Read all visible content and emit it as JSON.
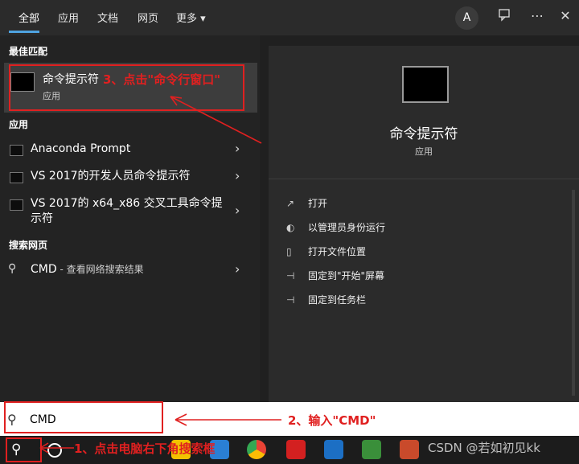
{
  "tabs": [
    "全部",
    "应用",
    "文档",
    "网页",
    "更多 ▾"
  ],
  "header": {
    "avatar": "A"
  },
  "best_match": {
    "heading": "最佳匹配",
    "title": "命令提示符",
    "subtitle": "应用"
  },
  "apps": {
    "heading": "应用",
    "items": [
      "Anaconda Prompt",
      "VS 2017的开发人员命令提示符",
      "VS 2017的 x64_x86 交叉工具命令提",
      "示符"
    ]
  },
  "web": {
    "heading": "搜索网页",
    "query": "CMD",
    "suffix": " - 查看网络搜索结果"
  },
  "preview": {
    "title": "命令提示符",
    "subtitle": "应用",
    "actions": [
      "打开",
      "以管理员身份运行",
      "打开文件位置",
      "固定到\"开始\"屏幕",
      "固定到任务栏"
    ]
  },
  "search": {
    "value": "CMD"
  },
  "annotations": {
    "step1": "1、点击电脑右下角搜索框",
    "step2": "2、输入\"CMD\"",
    "step3": "3、点击\"命令行窗口\""
  },
  "watermark": "CSDN @若如初见kk",
  "colors": {
    "annotation": "#e02020",
    "accent": "#4fa3e0"
  }
}
